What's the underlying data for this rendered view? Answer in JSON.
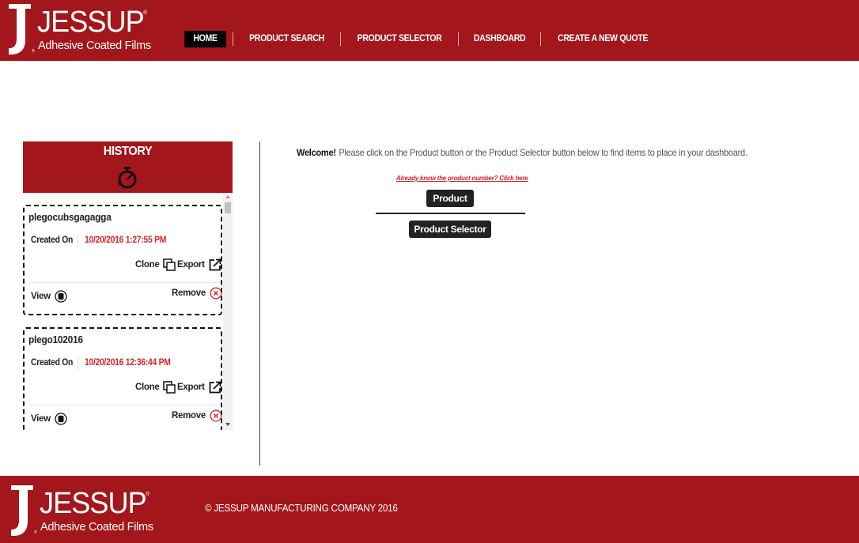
{
  "brand": {
    "name": "JESSUP",
    "tagline": "Adhesive Coated Films",
    "registered": "®",
    "color": "#a3161b"
  },
  "nav": {
    "items": [
      {
        "label": "HOME",
        "active": true
      },
      {
        "label": "PRODUCT SEARCH",
        "active": false
      },
      {
        "label": "PRODUCT SELECTOR",
        "active": false
      },
      {
        "label": "DASHBOARD",
        "active": false
      },
      {
        "label": "CREATE A NEW QUOTE",
        "active": false
      }
    ]
  },
  "history": {
    "title": "HISTORY",
    "icon": "stopwatch-icon",
    "items": [
      {
        "name": "plegocubsgagagga",
        "created_label": "Created On",
        "created_value": "10/20/2016 1:27:55 PM",
        "clone_label": "Clone",
        "export_label": "Export",
        "view_label": "View",
        "remove_label": "Remove"
      },
      {
        "name": "plego102016",
        "created_label": "Created On",
        "created_value": "10/20/2016 12:36:44 PM",
        "clone_label": "Clone",
        "export_label": "Export",
        "view_label": "View",
        "remove_label": "Remove"
      }
    ]
  },
  "main": {
    "welcome_strong": "Welcome!",
    "welcome_text": "Please click on the Product button or the Product Selector button below to find items to place in your dashboard.",
    "already_link": "Already know the product number? Click here",
    "product_button": "Product",
    "selector_button": "Product Selector"
  },
  "footer": {
    "copyright": "© JESSUP MANUFACTURING COMPANY 2016"
  },
  "colors": {
    "accent_red": "#d6252c",
    "dark_button": "#222222"
  }
}
